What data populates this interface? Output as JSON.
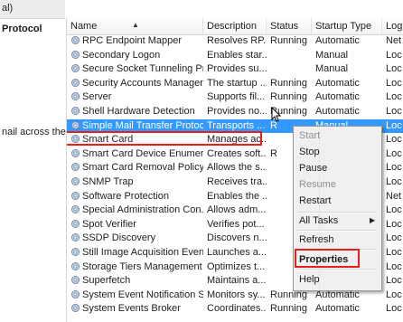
{
  "left_pane": {
    "top_label": "al)",
    "title": "Protocol",
    "description": "nail across the"
  },
  "columns": {
    "name": "Name",
    "description": "Description",
    "status": "Status",
    "startup_type": "Startup Type",
    "log_on": "Log"
  },
  "services": [
    {
      "name": "RPC Endpoint Mapper",
      "description": "Resolves RP...",
      "status": "Running",
      "startup": "Automatic",
      "logon": "Net"
    },
    {
      "name": "Secondary Logon",
      "description": "Enables star...",
      "status": "",
      "startup": "Manual",
      "logon": "Loc"
    },
    {
      "name": "Secure Socket Tunneling Pr...",
      "description": "Provides su...",
      "status": "",
      "startup": "Manual",
      "logon": "Loc"
    },
    {
      "name": "Security Accounts Manager",
      "description": "The startup ...",
      "status": "Running",
      "startup": "Automatic",
      "logon": "Loc"
    },
    {
      "name": "Server",
      "description": "Supports fil...",
      "status": "Running",
      "startup": "Automatic",
      "logon": "Loc"
    },
    {
      "name": "Shell Hardware Detection",
      "description": "Provides no...",
      "status": "Running",
      "startup": "Automatic",
      "logon": "Loc"
    },
    {
      "name": "Simple Mail Transfer Protoc...",
      "description": "Transports ...",
      "status": "R",
      "startup": "Manual",
      "logon": "Loc",
      "selected": true
    },
    {
      "name": "Smart Card",
      "description": "Manages ac...",
      "status": "",
      "startup": "",
      "logon": "Loc"
    },
    {
      "name": "Smart Card Device Enumera...",
      "description": "Creates soft...",
      "status": "R",
      "startup": "",
      "logon": "Loc"
    },
    {
      "name": "Smart Card Removal Policy",
      "description": "Allows the s...",
      "status": "",
      "startup": "",
      "logon": "Loc"
    },
    {
      "name": "SNMP Trap",
      "description": "Receives tra...",
      "status": "",
      "startup": "",
      "logon": "Loc"
    },
    {
      "name": "Software Protection",
      "description": "Enables the ...",
      "status": "",
      "startup": "",
      "logon": "Net"
    },
    {
      "name": "Special Administration Con...",
      "description": "Allows adm...",
      "status": "",
      "startup": "",
      "logon": "Loc"
    },
    {
      "name": "Spot Verifier",
      "description": "Verifies pot...",
      "status": "",
      "startup": "",
      "logon": "Loc"
    },
    {
      "name": "SSDP Discovery",
      "description": "Discovers n...",
      "status": "",
      "startup": "",
      "logon": "Loc"
    },
    {
      "name": "Still Image Acquisition Events",
      "description": "Launches a...",
      "status": "",
      "startup": "",
      "logon": "Loc"
    },
    {
      "name": "Storage Tiers Management",
      "description": "Optimizes t...",
      "status": "",
      "startup": "",
      "logon": "Loc"
    },
    {
      "name": "Superfetch",
      "description": "Maintains a...",
      "status": "",
      "startup": "",
      "logon": "Loc"
    },
    {
      "name": "System Event Notification S...",
      "description": "Monitors sy...",
      "status": "Running",
      "startup": "Automatic",
      "logon": "Loc"
    },
    {
      "name": "System Events Broker",
      "description": "Coordinates...",
      "status": "Running",
      "startup": "Automatic",
      "logon": "Loc"
    }
  ],
  "context_menu": {
    "start": "Start",
    "stop": "Stop",
    "pause": "Pause",
    "resume": "Resume",
    "restart": "Restart",
    "all_tasks": "All Tasks",
    "refresh": "Refresh",
    "properties": "Properties",
    "help": "Help"
  },
  "colors": {
    "selection": "#3399ff",
    "highlight_outline": "#e8201c"
  }
}
